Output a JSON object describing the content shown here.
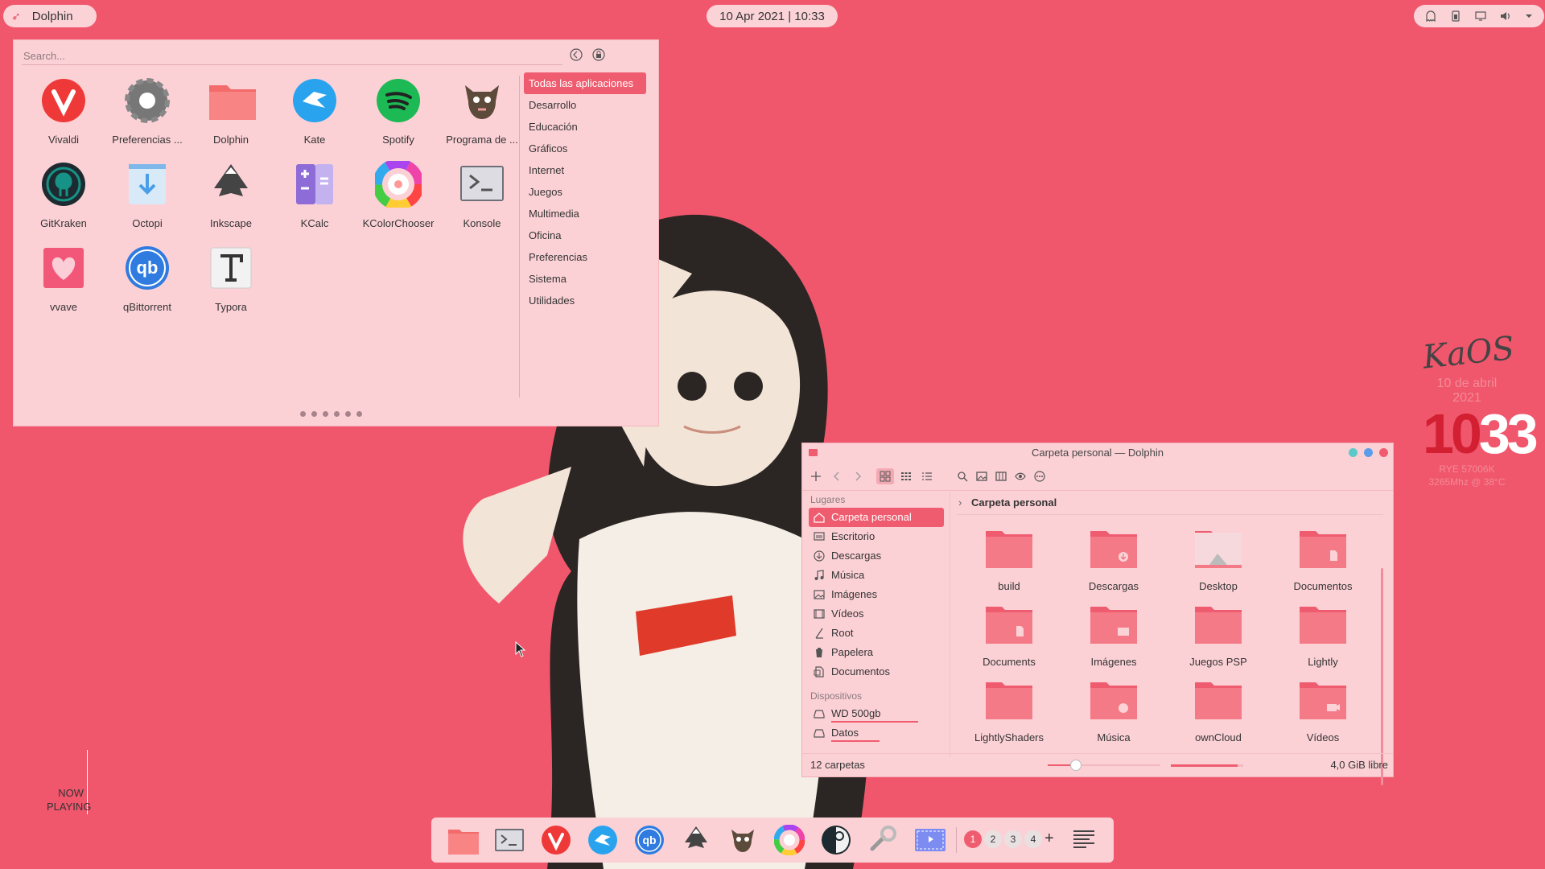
{
  "colors": {
    "background": "#f0566c",
    "accent": "#f05c6f",
    "panel": "#fcd1d6"
  },
  "top_panel": {
    "active_app": "Dolphin",
    "clock": "10 Apr 2021 | 10:33",
    "tray_icons": [
      "ghost-icon",
      "battery-icon",
      "display-icon",
      "volume-icon",
      "chevron-down-icon"
    ]
  },
  "launcher": {
    "search_placeholder": "Search...",
    "apps": [
      {
        "label": "Vivaldi",
        "icon": "vivaldi-icon"
      },
      {
        "label": "Preferencias ...",
        "icon": "settings-icon"
      },
      {
        "label": "Dolphin",
        "icon": "folder-icon"
      },
      {
        "label": "Kate",
        "icon": "kate-icon"
      },
      {
        "label": "Spotify",
        "icon": "spotify-icon"
      },
      {
        "label": "Programa de ...",
        "icon": "gimp-icon"
      },
      {
        "label": "GitKraken",
        "icon": "gitkraken-icon"
      },
      {
        "label": "Octopi",
        "icon": "octopi-icon"
      },
      {
        "label": "Inkscape",
        "icon": "inkscape-icon"
      },
      {
        "label": "KCalc",
        "icon": "kcalc-icon"
      },
      {
        "label": "KColorChooser",
        "icon": "color-wheel-icon"
      },
      {
        "label": "Konsole",
        "icon": "terminal-icon"
      },
      {
        "label": "vvave",
        "icon": "vvave-icon"
      },
      {
        "label": "qBittorrent",
        "icon": "qbittorrent-icon"
      },
      {
        "label": "Typora",
        "icon": "typora-icon"
      }
    ],
    "categories": [
      "Todas las aplicaciones",
      "Desarrollo",
      "Educación",
      "Gráficos",
      "Internet",
      "Juegos",
      "Multimedia",
      "Oficina",
      "Preferencias",
      "Sistema",
      "Utilidades"
    ],
    "active_category": "Todas las aplicaciones",
    "pages": 6,
    "current_page": 1
  },
  "clock_widget": {
    "logo": "KaOS",
    "date": "10 de abril 2021",
    "hour": "10",
    "minute": "33",
    "line1": "RYE 57006K",
    "line2": "3265Mhz @ 38°C"
  },
  "now_playing": {
    "line1": "NOW",
    "line2": "PLAYING"
  },
  "dolphin": {
    "title": "Carpeta personal — Dolphin",
    "places_heading": "Lugares",
    "places": [
      {
        "label": "Carpeta personal",
        "icon": "home-icon"
      },
      {
        "label": "Escritorio",
        "icon": "desktop-icon"
      },
      {
        "label": "Descargas",
        "icon": "download-icon"
      },
      {
        "label": "Música",
        "icon": "music-icon"
      },
      {
        "label": "Imágenes",
        "icon": "image-icon"
      },
      {
        "label": "Vídeos",
        "icon": "video-icon"
      },
      {
        "label": "Root",
        "icon": "root-icon"
      },
      {
        "label": "Papelera",
        "icon": "trash-icon"
      },
      {
        "label": "Documentos",
        "icon": "document-icon"
      }
    ],
    "devices_heading": "Dispositivos",
    "devices": [
      {
        "label": "WD 500gb",
        "icon": "drive-icon",
        "usage": 0.9
      },
      {
        "label": "Datos",
        "icon": "drive-icon",
        "usage": 0.5
      }
    ],
    "breadcrumb": "Carpeta personal",
    "folders": [
      "build",
      "Descargas",
      "Desktop",
      "Documentos",
      "Documents",
      "Imágenes",
      "Juegos PSP",
      "Lightly",
      "LightlyShaders",
      "Música",
      "ownCloud",
      "Vídeos"
    ],
    "status_text": "12 carpetas",
    "zoom_level": 0.25,
    "free_space_fraction": 0.92,
    "free_space": "4,0 GiB libre"
  },
  "dock": {
    "apps": [
      "folder-icon",
      "terminal-icon",
      "vivaldi-icon",
      "kate-icon",
      "qbittorrent-icon",
      "inkscape-icon",
      "gimp-icon",
      "color-wheel-icon",
      "steam-icon",
      "settings-tool-icon",
      "screen-capture-icon"
    ],
    "desktops": [
      "1",
      "2",
      "3",
      "4"
    ],
    "add_desktop": "+"
  }
}
